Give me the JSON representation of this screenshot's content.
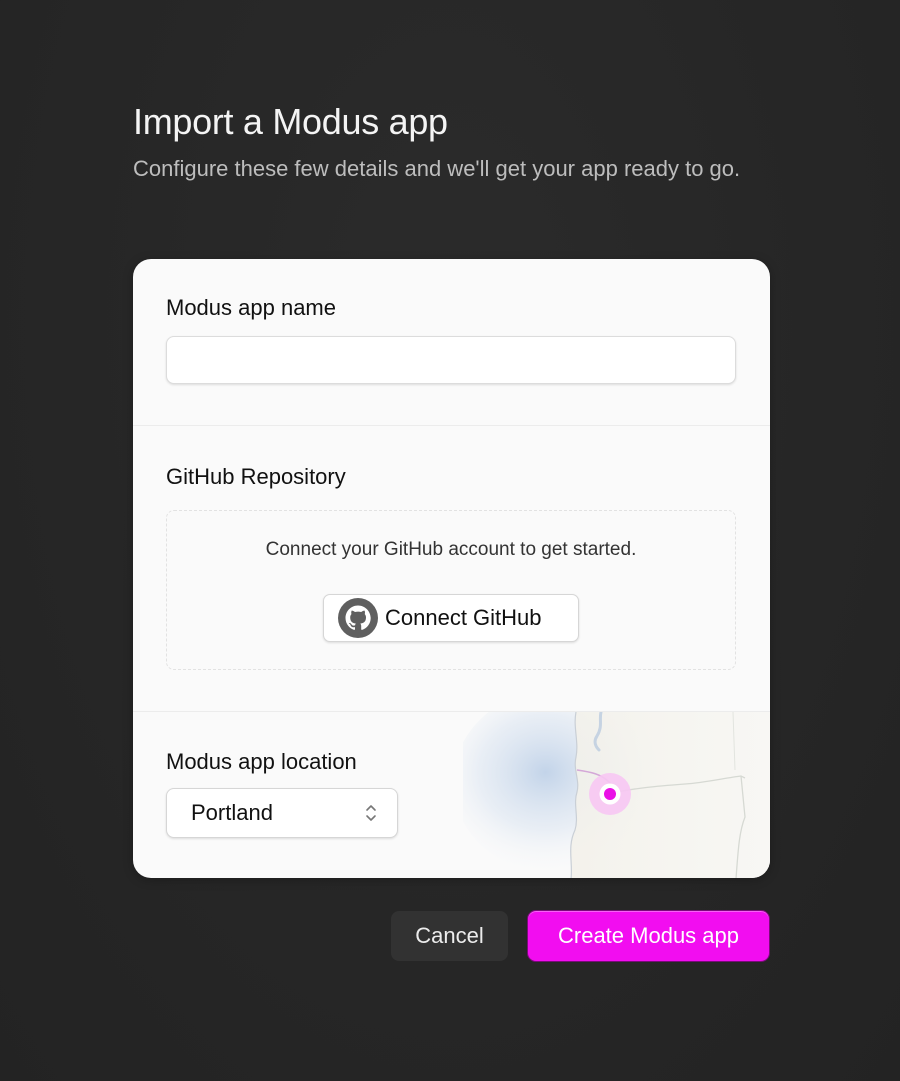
{
  "header": {
    "title": "Import a Modus app",
    "subtitle": "Configure these few details and we'll get your app ready to go."
  },
  "form": {
    "name_section": {
      "label": "Modus app name",
      "input_value": "",
      "input_placeholder": ""
    },
    "repo_section": {
      "label": "GitHub Repository",
      "connect_prompt": "Connect your GitHub account to get started.",
      "connect_button_label": "Connect GitHub",
      "connect_button_icon": "github-icon"
    },
    "location_section": {
      "label": "Modus app location",
      "selected_location": "Portland",
      "select_icon": "chevron-up-down-icon",
      "map_marker_icon": "location-marker-icon"
    }
  },
  "actions": {
    "cancel_label": "Cancel",
    "create_label": "Create Modus app"
  },
  "colors": {
    "background": "#262626",
    "card": "#fafafa",
    "accent": "#f20df0",
    "accent_border": "#7a0a79",
    "cancel_bg": "#323232"
  }
}
